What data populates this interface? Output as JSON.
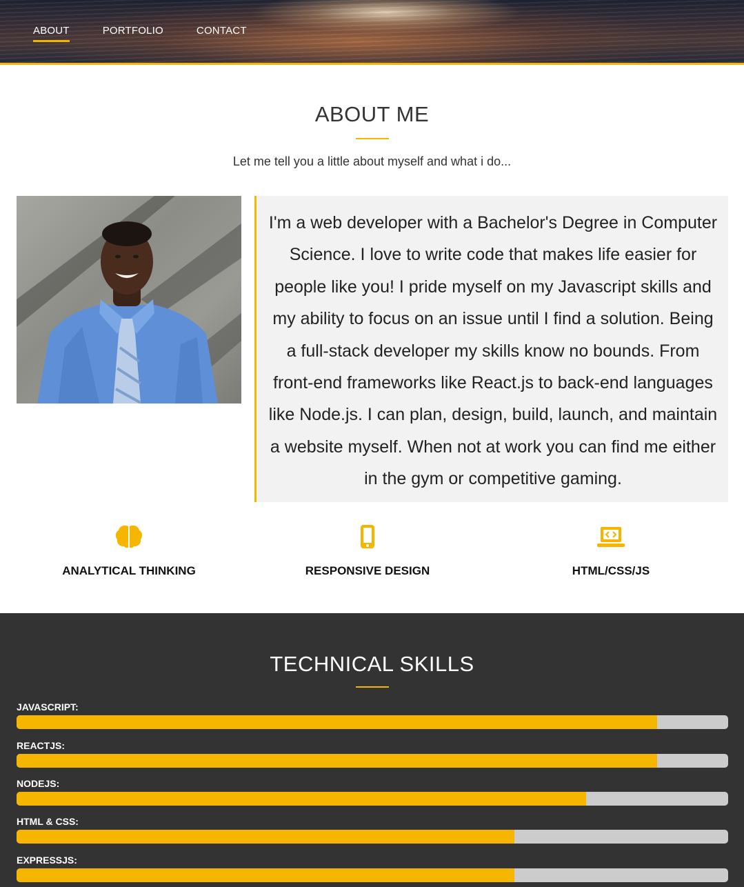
{
  "nav": {
    "items": [
      {
        "label": "ABOUT",
        "active": true
      },
      {
        "label": "PORTFOLIO",
        "active": false
      },
      {
        "label": "CONTACT",
        "active": false
      }
    ]
  },
  "about": {
    "title": "ABOUT ME",
    "subtitle": "Let me tell you a little about myself and what i do...",
    "bio": "I'm a web developer with a Bachelor's Degree in Computer Science. I love to write code that makes life easier for people like you! I pride myself on my Javascript skills and my ability to focus on an issue until I find a solution. Being a full-stack developer my skills know no bounds. From front-end frameworks like React.js to back-end languages like Node.js. I can plan, design, build, launch, and maintain a website myself. When not at work you can find me either in the gym or competitive gaming."
  },
  "features": [
    {
      "label": "ANALYTICAL THINKING",
      "icon": "brain-icon"
    },
    {
      "label": "RESPONSIVE DESIGN",
      "icon": "mobile-phone-icon"
    },
    {
      "label": "HTML/CSS/JS",
      "icon": "laptop-code-icon"
    }
  ],
  "skills": {
    "title": "TECHNICAL SKILLS",
    "items": [
      {
        "label": "JAVASCRIPT:",
        "level": 0.9
      },
      {
        "label": "REACTJS:",
        "level": 0.9
      },
      {
        "label": "NODEJS:",
        "level": 0.8
      },
      {
        "label": "HTML & CSS:",
        "level": 0.7
      },
      {
        "label": "EXPRESSJS:",
        "level": 0.7
      }
    ]
  },
  "colors": {
    "accent": "#f6b600",
    "dark_section": "#333333",
    "track": "#cccccc",
    "bio_background": "#f2f2f2"
  }
}
